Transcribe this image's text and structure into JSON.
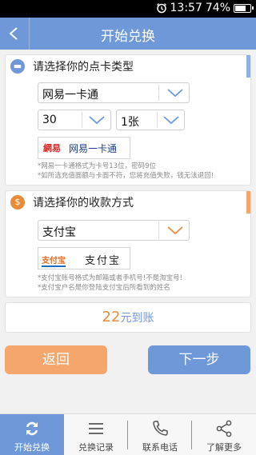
{
  "status": {
    "time": "13:57",
    "battery": "74%",
    "battery_level": 0.74
  },
  "header": {
    "title": "开始兑换"
  },
  "card_section": {
    "title": "请选择你的点卡类型",
    "card_type": "网易一卡通",
    "denomination": "30",
    "quantity": "1张",
    "logo_label": "网易一卡通",
    "logo_mark": "網易",
    "notes": [
      "*网易一卡通格式为卡号13位，密码9位",
      "*如所选充值面额与卡面不符，您将充值失败，钱无法退回!"
    ]
  },
  "payment_section": {
    "title": "请选择你的收款方式",
    "method": "支付宝",
    "logo_label": "支付宝",
    "logo_mark": "支付宝",
    "notes": [
      "*支付宝账号格式为邮箱或者手机号!不是淘宝号!",
      "*支付宝户名是你登陆支付宝后所看到的姓名"
    ]
  },
  "total": {
    "amount": "22",
    "unit": "元到账"
  },
  "buttons": {
    "back": "返回",
    "next": "下一步"
  },
  "tabs": [
    {
      "label": "开始兑换",
      "icon": "refresh-icon",
      "active": true
    },
    {
      "label": "兑换记录",
      "icon": "list-icon",
      "active": false
    },
    {
      "label": "联系电话",
      "icon": "phone-icon",
      "active": false
    },
    {
      "label": "了解更多",
      "icon": "share-icon",
      "active": false
    }
  ],
  "colors": {
    "primary": "#6f98d8",
    "orange": "#f4a66c",
    "accent_orange": "#e88c3c"
  }
}
